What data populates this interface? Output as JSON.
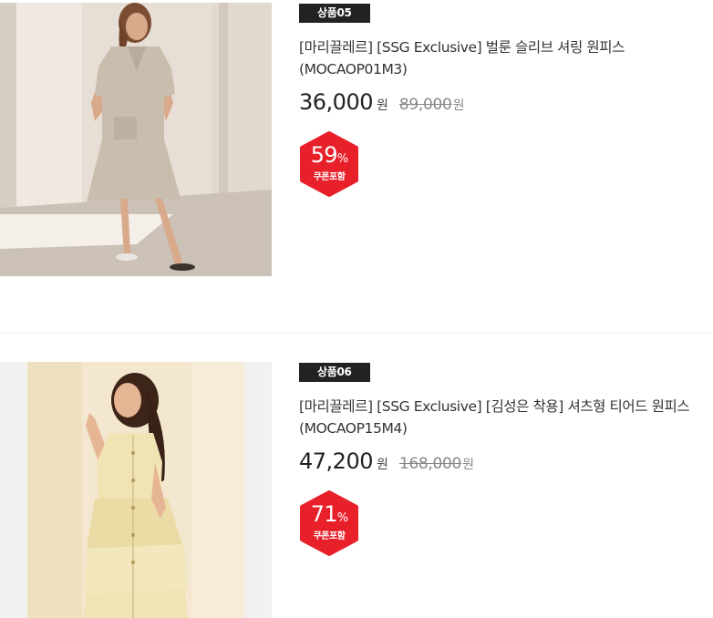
{
  "products": [
    {
      "badge": "상품05",
      "name": "[마리끌레르] [SSG Exclusive] 벌룬 슬리브 셔링 원피스 (MOCAOP01M3)",
      "price": "36,000",
      "currency": "원",
      "original_price": "89,000",
      "original_currency": "원",
      "discount_rate": "59",
      "discount_unit": "%",
      "coupon_label": "쿠폰포함",
      "image_alt": "beige-dress-photo"
    },
    {
      "badge": "상품06",
      "name": "[마리끌레르] [SSG Exclusive] [김성은 착용] 셔츠형 티어드 원피스 (MOCAOP15M4)",
      "price": "47,200",
      "currency": "원",
      "original_price": "168,000",
      "original_currency": "원",
      "discount_rate": "71",
      "discount_unit": "%",
      "coupon_label": "쿠폰포함",
      "image_alt": "yellow-dress-photo"
    }
  ],
  "colors": {
    "badge_bg": "#222222",
    "discount_red": "#e8202a",
    "price_text": "#222222",
    "original_price_text": "#888888"
  }
}
